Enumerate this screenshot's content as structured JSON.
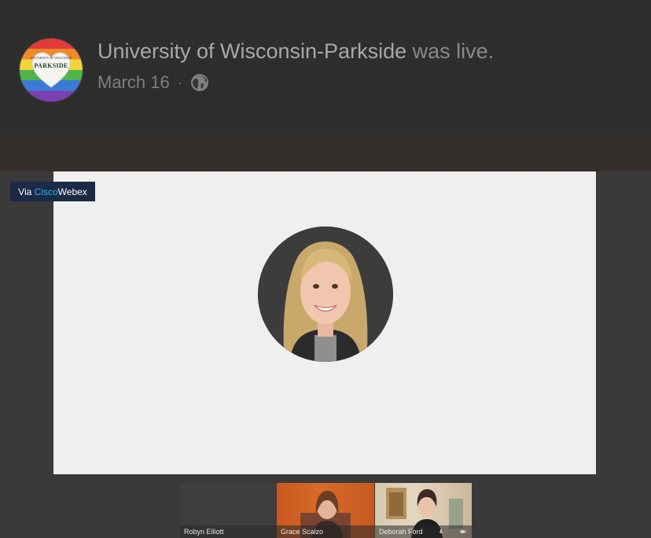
{
  "post": {
    "page_name": "University of Wisconsin-Parkside",
    "action": "was live.",
    "date": "March 16",
    "separator": "·",
    "privacy_icon": "globe-icon"
  },
  "avatar": {
    "logo_top": "UNIVERSITY OF WISCONSIN",
    "logo_main": "PARKSIDE"
  },
  "stream": {
    "badge_prefix": "Via ",
    "badge_brand": "Cisco",
    "badge_product": "Webex"
  },
  "participants": [
    {
      "name": "Robyn Elliott"
    },
    {
      "name": "Grace Scalzo"
    },
    {
      "name": "Deborah Ford"
    }
  ],
  "colors": {
    "badge_bg": "#1b2a45",
    "badge_brand": "#28b7ec",
    "slide_bg": "#efefef"
  }
}
